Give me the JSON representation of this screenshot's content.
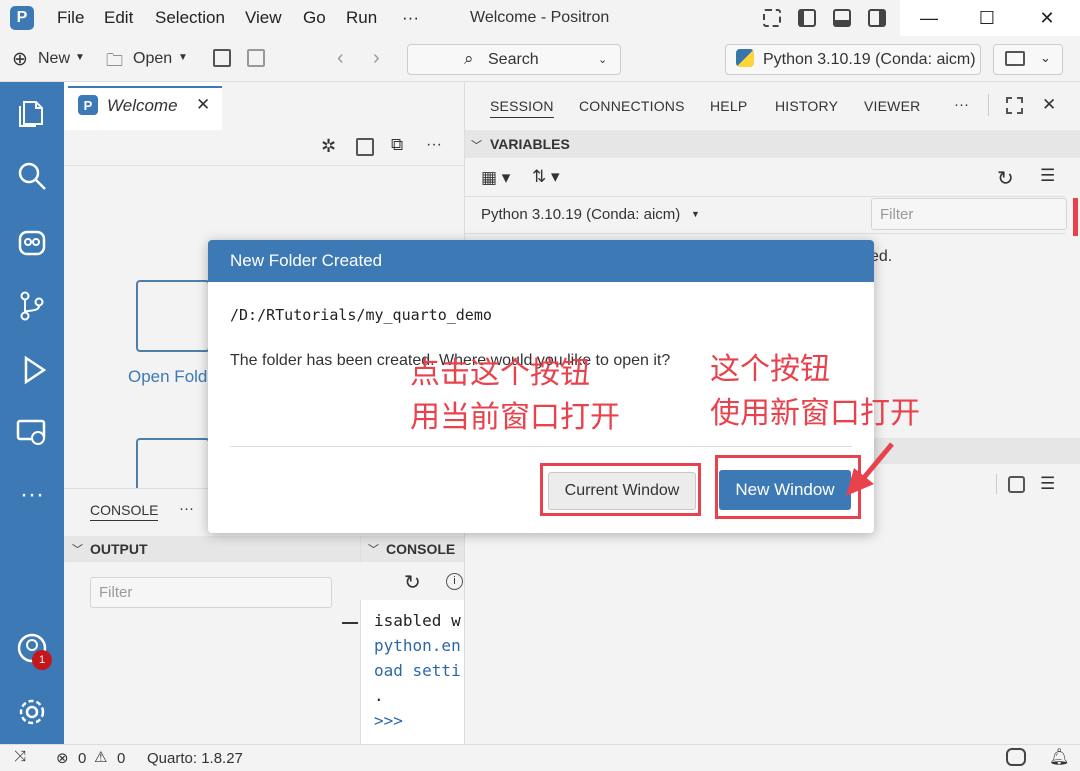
{
  "app": {
    "logo_letter": "P",
    "menu": [
      "File",
      "Edit",
      "Selection",
      "View",
      "Go",
      "Run",
      "···"
    ],
    "window_title": "Welcome - Positron",
    "window_controls": {
      "minimize": "—",
      "maximize": "☐",
      "close": "✕"
    }
  },
  "toolbar": {
    "new_label": "New",
    "open_label": "Open",
    "search_label": "Search",
    "interpreter_label": "Python 3.10.19 (Conda: aicm)"
  },
  "editor": {
    "tab_label": "Welcome",
    "open_folder_label": "Open Fold",
    "toolbar_more": "···"
  },
  "bottom_left": {
    "tab_label": "CONSOLE",
    "more": "···",
    "output_label": "OUTPUT",
    "console_label": "CONSOLE",
    "filter_placeholder": "Filter",
    "console_lines": [
      "isabled w",
      "python.en",
      "oad setti",
      ".",
      ">>>"
    ]
  },
  "right_panel": {
    "tabs": [
      "SESSION",
      "CONNECTIONS",
      "HELP",
      "HISTORY",
      "VIEWER"
    ],
    "more": "···",
    "variables_label": "VARIABLES",
    "interpreter_label": "Python 3.10.19 (Conda: aicm)",
    "filter_placeholder": "Filter",
    "partial_text": "ed."
  },
  "statusbar": {
    "errors": "0",
    "warnings": "0",
    "quarto": "Quarto: 1.8.27"
  },
  "dialog": {
    "title": "New Folder Created",
    "path": "/D:/RTutorials/my_quarto_demo",
    "message": "The folder has been created. Where would you like to open it?",
    "current_window_label": "Current Window",
    "new_window_label": "New Window"
  },
  "annotations": {
    "left_line1": "点击这个按钮",
    "left_line2": "用当前窗口打开",
    "right_line1": "这个按钮",
    "right_line2": "使用新窗口打开"
  },
  "badges": {
    "account_count": "1"
  },
  "colors": {
    "accent": "#3c79b5",
    "annotation": "#e8424c",
    "badge": "#c4161c"
  }
}
